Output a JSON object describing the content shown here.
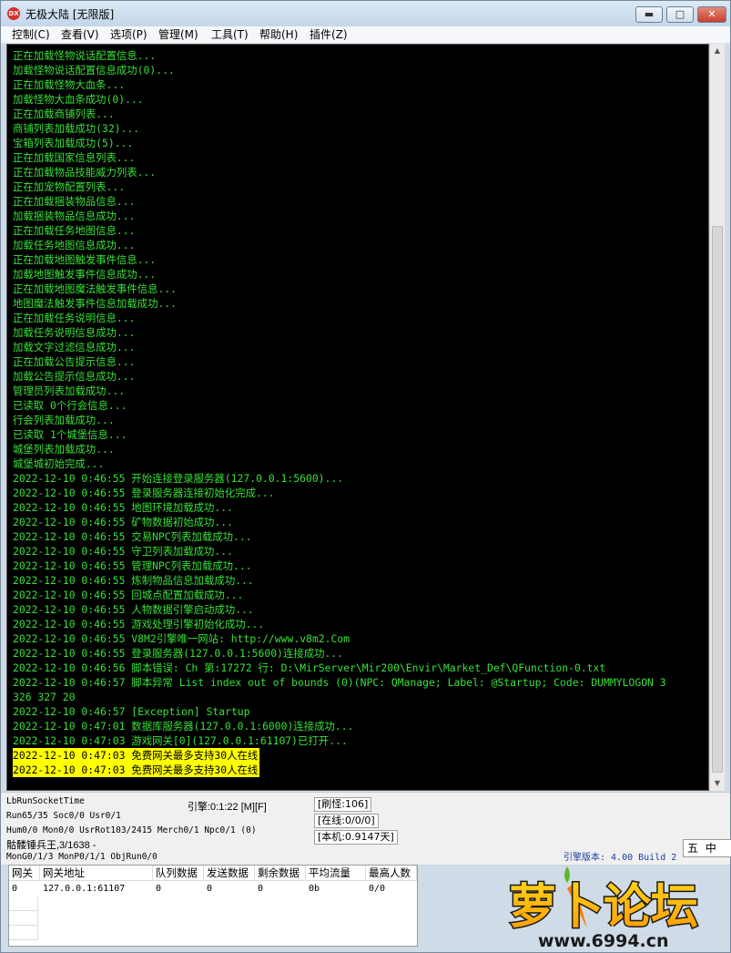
{
  "window": {
    "icon_text": "DX",
    "title": "无极大陆 [无限版]",
    "min_glyph": "▬",
    "max_glyph": "□",
    "close_glyph": "✕"
  },
  "menu": [
    "控制(C)",
    "查看(V)",
    "选项(P)",
    "管理(M)",
    "工具(T)",
    "帮助(H)",
    "插件(Z)"
  ],
  "console": {
    "lines": [
      "正在加载怪物说话配置信息...",
      "加载怪物说话配置信息成功(0)...",
      "正在加载怪物大血条...",
      "加载怪物大血条成功(0)...",
      "正在加载商铺列表...",
      "商铺列表加载成功(32)...",
      "宝箱列表加载成功(5)...",
      "正在加载国家信息列表...",
      "正在加载物品技能威力列表...",
      "正在加宠物配置列表...",
      "正在加载捆装物品信息...",
      "加载捆装物品信息成功...",
      "正在加载任务地图信息...",
      "加载任务地图信息成功...",
      "正在加载地图触发事件信息...",
      "加载地图触发事件信息成功...",
      "正在加载地图魔法触发事件信息...",
      "地图魔法触发事件信息加载成功...",
      "正在加载任务说明信息...",
      "加载任务说明信息成功...",
      "加载文字过滤信息成功...",
      "正在加载公告提示信息...",
      "加载公告提示信息成功...",
      "管理员列表加载成功...",
      "已读取 0个行会信息...",
      "行会列表加载成功...",
      "已读取 1个城堡信息...",
      "城堡列表加载成功...",
      "城堡城初始完成...",
      "2022-12-10 0:46:55 开始连接登录服务器(127.0.0.1:5600)...",
      "2022-12-10 0:46:55 登录服务器连接初始化完成...",
      "2022-12-10 0:46:55 地图环境加载成功...",
      "2022-12-10 0:46:55 矿物数据初始成功...",
      "2022-12-10 0:46:55 交易NPC列表加载成功...",
      "2022-12-10 0:46:55 守卫列表加载成功...",
      "2022-12-10 0:46:55 管理NPC列表加载成功...",
      "2022-12-10 0:46:55 炼制物品信息加载成功...",
      "2022-12-10 0:46:55 回城点配置加载成功...",
      "2022-12-10 0:46:55 人物数据引擎启动成功...",
      "2022-12-10 0:46:55 游戏处理引擎初始化成功...",
      "2022-12-10 0:46:55 V8M2引擎唯一网站: http://www.v8m2.Com",
      "2022-12-10 0:46:55 登录服务器(127.0.0.1:5600)连接成功...",
      "2022-12-10 0:46:56 脚本错误: Ch 第:17272 行: D:\\MirServer\\Mir200\\Envir\\Market_Def\\QFunction-0.txt",
      "2022-12-10 0:46:57 脚本异常 List index out of bounds (0)(NPC: QManage; Label: @Startup; Code: DUMMYLOGON 3",
      "326 327 20",
      "2022-12-10 0:46:57 [Exception] Startup",
      "2022-12-10 0:47:01 数据库服务器(127.0.0.1:6000)连接成功...",
      "2022-12-10 0:47:03 游戏网关[0](127.0.0.1:61107)已打开..."
    ],
    "highlighted_lines": [
      "2022-12-10 0:47:03 免费网关最多支持30人在线",
      "2022-12-10 0:47:03 免费网关最多支持30人在线"
    ],
    "text_color": "#38e038",
    "highlight_color": "#ffff00"
  },
  "status": {
    "lb_run_socket_time": "LbRunSocketTime",
    "run_line": "Run65/35 Soc0/0 Usr0/1",
    "hum_line": "Hum0/0 Mon0/0 UsrRot103/2415 Merch0/1 Npc0/1 (0)",
    "monster_line": "骷髅锤兵王,3/1638 -",
    "mon_line": "MonG0/1/3 MonP0/1/1 ObjRun0/0",
    "engine_time": "引擎:0:1:22 [M][F]",
    "refresh_monster": "[刷怪:106]",
    "online": "[在线:0/0/0]",
    "local": "[本机:0.9147天]",
    "engine_version": "引擎版本: 4.00 Build 2",
    "ime_icon": "五",
    "ime_text": "中"
  },
  "gateway_table": {
    "headers": [
      "网关",
      "网关地址",
      "队列数据",
      "发送数据",
      "剩余数据",
      "平均流量",
      "最高人数"
    ],
    "rows": [
      [
        "0",
        "127.0.0.1:61107",
        "0",
        "0",
        "0",
        "0b",
        "0/0"
      ]
    ]
  },
  "watermark": {
    "brand": "萝卜论坛",
    "url": "www.6994.cn"
  }
}
